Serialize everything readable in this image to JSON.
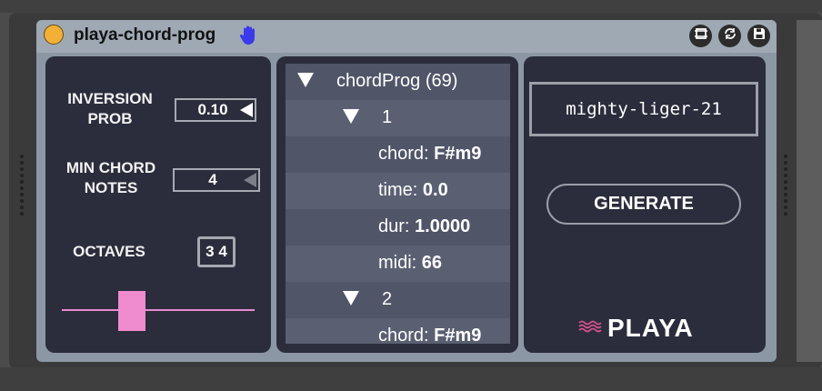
{
  "device": {
    "title": "playa-chord-prog",
    "power_color": "#f2b036",
    "hand_icon": "hand-icon",
    "buttons": [
      "freeze-icon",
      "refresh-icon",
      "save-icon"
    ]
  },
  "left_panel": {
    "inversion_label_1": "INVERSION",
    "inversion_label_2": "PROB",
    "inversion_value": "0.10",
    "min_chord_label_1": "MIN CHORD",
    "min_chord_label_2": "NOTES",
    "min_chord_value": "4",
    "octaves_label": "OCTAVES",
    "octaves_value": "3 4",
    "slider_color": "#ef8cd0"
  },
  "tree": {
    "root_label": "chordProg (69)",
    "node1_label": "1",
    "chord_key": "chord:",
    "chord1_value": "F#m9",
    "time_key": "time:",
    "time_value": "0.0",
    "dur_key": "dur:",
    "dur_value": "1.0000",
    "midi_key": "midi:",
    "midi_value": "66",
    "node2_label": "2",
    "chord2_value": "F#m9"
  },
  "right_panel": {
    "name": "mighty-liger-21",
    "generate_label": "GENERATE",
    "brand": "PLAYA"
  }
}
